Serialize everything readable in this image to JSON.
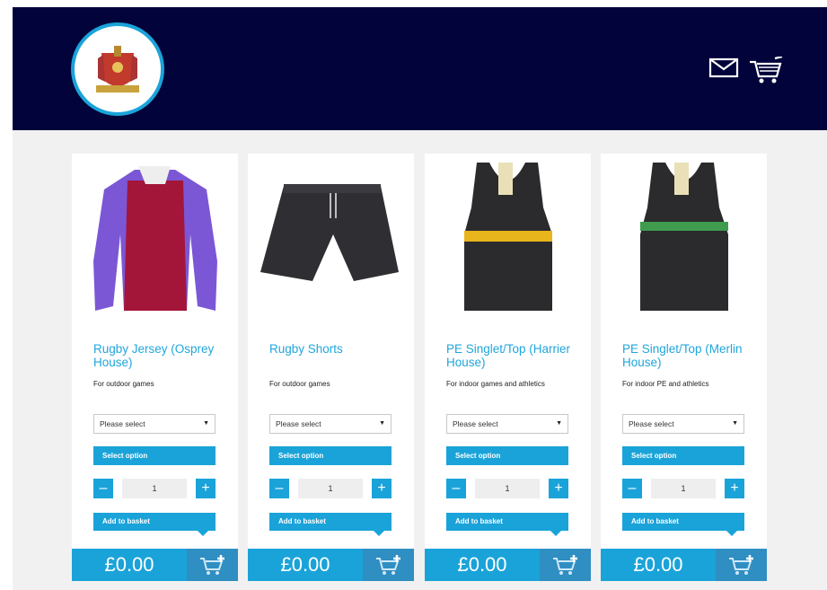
{
  "header": {
    "logo_icon": "school-crest-logo",
    "icons": [
      "mail-icon",
      "cart-icon"
    ]
  },
  "products": [
    {
      "name": "Rugby Jersey (Osprey House)",
      "description": "For outdoor games",
      "image_icon": "rugby-jersey-image",
      "select_placeholder": "Please select",
      "select_option_label": "Select option",
      "quantity": "1",
      "add_label": "Add to basket",
      "price": "£0.00"
    },
    {
      "name": "Rugby Shorts",
      "description": "For outdoor games",
      "image_icon": "rugby-shorts-image",
      "select_placeholder": "Please select",
      "select_option_label": "Select option",
      "quantity": "1",
      "add_label": "Add to basket",
      "price": "£0.00"
    },
    {
      "name": "PE Singlet/Top (Harrier House)",
      "description": "For indoor games and athletics",
      "image_icon": "pe-singlet-yellow-image",
      "select_placeholder": "Please select",
      "select_option_label": "Select option",
      "quantity": "1",
      "add_label": "Add to basket",
      "price": "£0.00"
    },
    {
      "name": "PE Singlet/Top (Merlin House)",
      "description": "For indoor PE and athletics",
      "image_icon": "pe-singlet-green-image",
      "select_placeholder": "Please select",
      "select_option_label": "Select option",
      "quantity": "1",
      "add_label": "Add to basket",
      "price": "£0.00"
    }
  ],
  "colors": {
    "header_bg": "#02033a",
    "accent": "#1aa3d9",
    "page_bg": "#f1f1f1"
  }
}
